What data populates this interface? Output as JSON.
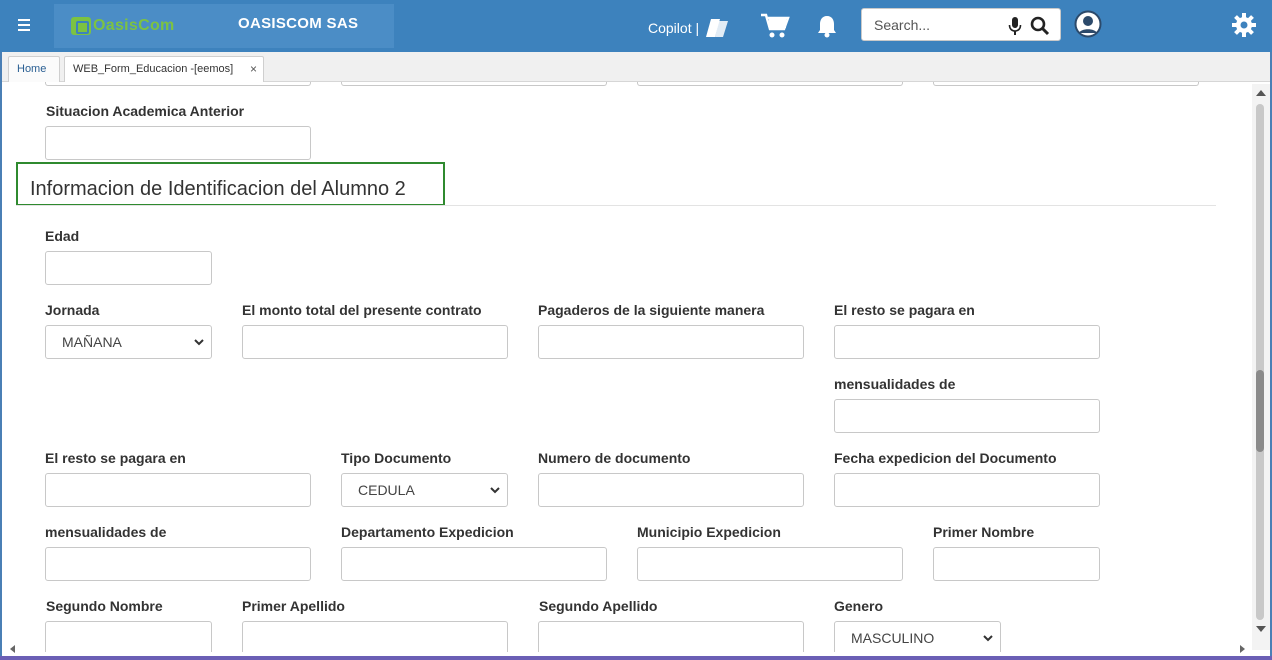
{
  "header": {
    "logo_text": "OasisCom",
    "company": "OASISCOM SAS",
    "copilot_label": "Copilot |",
    "search_placeholder": "Search...",
    "colors": {
      "bar": "#3d82bd",
      "logo_green": "#7cc242",
      "section_border": "#2f8a2f"
    }
  },
  "tabs": {
    "home": "Home",
    "form": "WEB_Form_Educacion -[eemos]",
    "close": "×"
  },
  "form": {
    "prev_label": "Situacion Academica Anterior",
    "section_title": "Informacion de Identificacion del Alumno 2",
    "edad": "Edad",
    "jornada": "Jornada",
    "jornada_value": "MAÑANA",
    "monto_total": "El monto total del presente contrato",
    "pagaderos": "Pagaderos de la siguiente manera",
    "resto_pagara_1": "El resto se pagara en",
    "mensualidades_1": "mensualidades de",
    "resto_pagara_2": "El resto se pagara en",
    "tipo_documento": "Tipo Documento",
    "tipo_documento_value": "CEDULA",
    "numero_documento": "Numero de documento",
    "fecha_expedicion": "Fecha expedicion del Documento",
    "mensualidades_2": "mensualidades de",
    "departamento": "Departamento Expedicion",
    "municipio": "Municipio Expedicion",
    "primer_nombre": "Primer Nombre",
    "segundo_nombre": "Segundo Nombre",
    "primer_apellido": "Primer Apellido",
    "segundo_apellido": "Segundo Apellido",
    "genero": "Genero",
    "genero_value": "MASCULINO"
  }
}
